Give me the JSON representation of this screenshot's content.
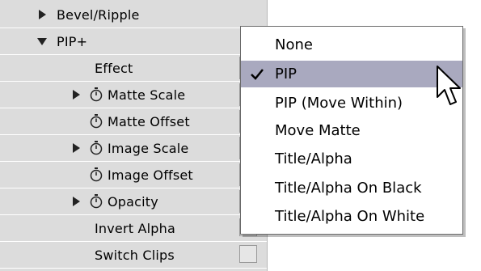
{
  "panel": {
    "rows": [
      {
        "label": "Bevel/Ripple"
      },
      {
        "label": "PIP+"
      },
      {
        "label": "Effect"
      },
      {
        "label": "Matte Scale"
      },
      {
        "label": "Matte Offset"
      },
      {
        "label": "Image Scale"
      },
      {
        "label": "Image Offset"
      },
      {
        "label": "Opacity"
      },
      {
        "label": "Invert Alpha"
      },
      {
        "label": "Switch Clips"
      }
    ]
  },
  "dropdown": {
    "selected": "PIP",
    "options": [
      "None",
      "PIP",
      "PIP (Move Within)",
      "Move Matte",
      "Title/Alpha",
      "Title/Alpha On Black",
      "Title/Alpha On White"
    ]
  },
  "colors": {
    "panel_bg": "#dcdcdc",
    "menu_highlight": "#a9a9bf"
  },
  "icons": {
    "expand": "triangle-right-icon",
    "collapse": "triangle-down-icon",
    "keyframe": "stopwatch-icon",
    "check": "checkmark-icon",
    "cursor": "arrow-cursor-icon"
  }
}
